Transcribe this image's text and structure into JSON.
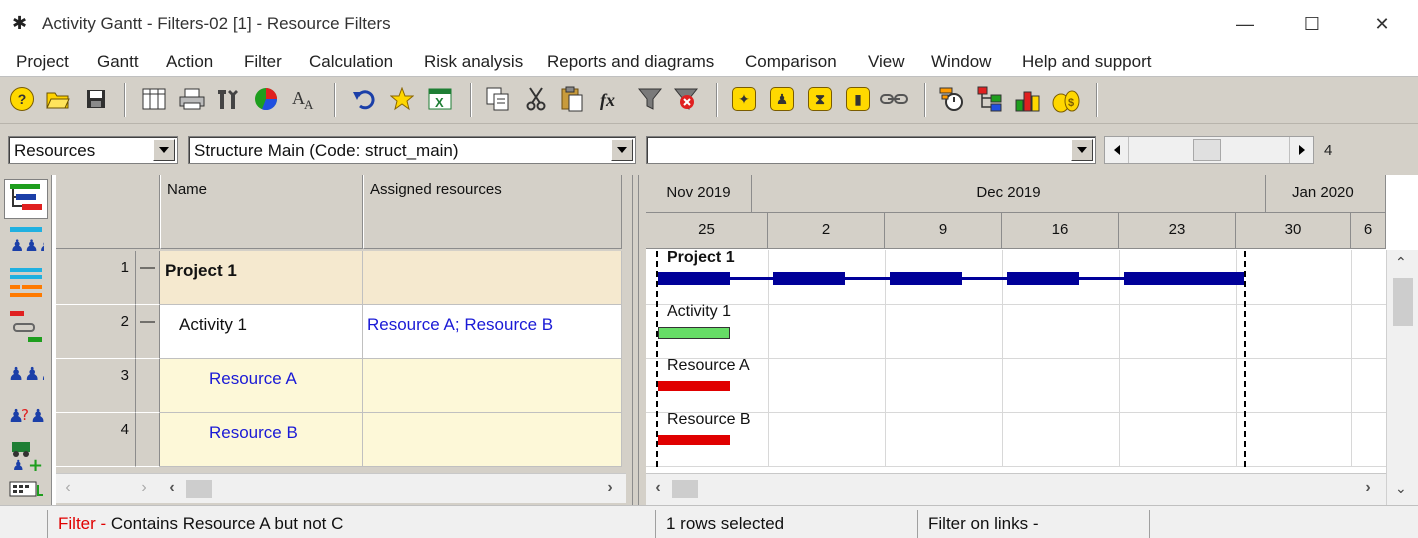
{
  "window": {
    "title": "Activity Gantt - Filters-02 [1] - Resource Filters",
    "minimize_glyph": "—",
    "maximize_glyph": "☐",
    "close_glyph": "✕"
  },
  "menu": [
    "Project",
    "Gantt",
    "Action",
    "Filter",
    "Calculation",
    "Risk analysis",
    "Reports and diagrams",
    "Comparison",
    "View",
    "Window",
    "Help and support"
  ],
  "toolbar_icons": [
    "help-icon",
    "open-folder-icon",
    "save-icon",
    "columns-icon",
    "print-icon",
    "tools-icon",
    "pie-chart-icon",
    "font-icon",
    "undo-icon",
    "favorite-star-icon",
    "excel-icon",
    "copy-icon",
    "cut-icon",
    "paste-icon",
    "formula-icon",
    "filter-icon",
    "clear-filter-icon",
    "walking-person-icon",
    "person-icon",
    "hourglass-icon",
    "bolt-icon",
    "link-icon",
    "timer-icon",
    "hierarchy-icon",
    "chart-bars-icon",
    "money-bags-icon"
  ],
  "combos": {
    "view_select": "Resources",
    "structure_select": "Structure Main (Code: struct_main)",
    "filter_select": ""
  },
  "zoom_value": "4",
  "left_strip_icons": [
    "gantt-view-icon",
    "resource-team-icon",
    "resource-gantt-icon",
    "link-view-icon",
    "resources-view-icon",
    "unassigned-resource-icon",
    "equipment-icon",
    "calendar-view-icon"
  ],
  "grid": {
    "headers": [
      "Name",
      "Assigned resources"
    ],
    "rows": [
      {
        "num": "1",
        "toggle": "—",
        "name": "Project 1",
        "resources": "",
        "type": "project"
      },
      {
        "num": "2",
        "toggle": "—",
        "name": "Activity 1",
        "resources": "Resource A; Resource B",
        "type": "activity"
      },
      {
        "num": "3",
        "toggle": "",
        "name": "Resource A",
        "resources": "",
        "type": "resource"
      },
      {
        "num": "4",
        "toggle": "",
        "name": "Resource B",
        "resources": "",
        "type": "resource"
      }
    ]
  },
  "gantt": {
    "months": [
      "Nov 2019",
      "Dec 2019",
      "Jan 2020"
    ],
    "weeks": [
      "25",
      "2",
      "9",
      "16",
      "23",
      "30",
      "6"
    ],
    "bars": [
      {
        "label": "Project 1",
        "color": "#000099"
      },
      {
        "label": "Activity 1",
        "color": "#66dd66"
      },
      {
        "label": "Resource A",
        "color": "#e00000"
      },
      {
        "label": "Resource B",
        "color": "#e00000"
      }
    ]
  },
  "status": {
    "filter_label": "Filter -",
    "filter_text": "Contains Resource A but not C",
    "selection": "1 rows selected",
    "links_filter": "Filter on links -"
  },
  "colors": {
    "toolbar_bg": "#d4d0c8",
    "project_row_bg": "#f5e9cf",
    "resource_row_bg": "#fdf8d8",
    "link_blue": "#1a1ad6",
    "filter_red": "#e00000"
  }
}
